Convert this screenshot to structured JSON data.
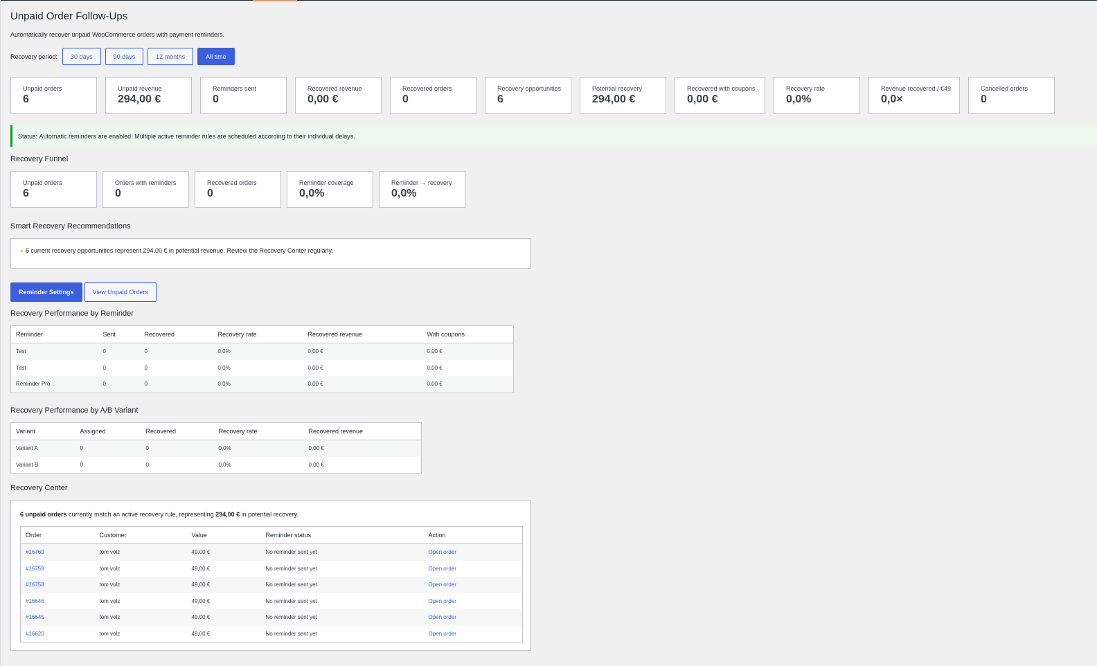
{
  "page": {
    "title": "Unpaid Order Follow-Ups",
    "subtitle": "Automatically recover unpaid WooCommerce orders with payment reminders."
  },
  "period": {
    "label": "Recovery period:",
    "options": [
      "30 days",
      "90 days",
      "12 months",
      "All time"
    ],
    "selected": "All time"
  },
  "stats": [
    {
      "label": "Unpaid orders",
      "value": "6"
    },
    {
      "label": "Unpaid revenue",
      "value": "294,00 €"
    },
    {
      "label": "Reminders sent",
      "value": "0"
    },
    {
      "label": "Recovered revenue",
      "value": "0,00 €"
    },
    {
      "label": "Recovered orders",
      "value": "0"
    },
    {
      "label": "Recovery opportunities",
      "value": "6"
    },
    {
      "label": "Potential recovery",
      "value": "294,00 €"
    },
    {
      "label": "Recovered with coupons",
      "value": "0,00 €"
    },
    {
      "label": "Recovery rate",
      "value": "0,0%"
    },
    {
      "label": "Revenue recovered / €49",
      "value": "0,0×"
    },
    {
      "label": "Cancelled orders",
      "value": "0"
    }
  ],
  "status": {
    "prefix": "Status:",
    "text": "Automatic reminders are enabled. Multiple active reminder rules are scheduled according to their individual delays."
  },
  "funnel": {
    "title": "Recovery Funnel",
    "items": [
      {
        "label": "Unpaid orders",
        "value": "6"
      },
      {
        "label": "Orders with reminders",
        "value": "0"
      },
      {
        "label": "Recovered orders",
        "value": "0"
      },
      {
        "label": "Reminder coverage",
        "value": "0,0%"
      },
      {
        "label": "Reminder → recovery",
        "value": "0,0%"
      }
    ]
  },
  "recommendations": {
    "title": "Smart Recovery Recommendations",
    "text": "6 current recovery opportunities represent 294,00 € in potential revenue. Review the Recovery Center regularly."
  },
  "actions": {
    "settings": "Reminder Settings",
    "view_unpaid": "View Unpaid Orders"
  },
  "by_reminder": {
    "title": "Recovery Performance by Reminder",
    "columns": [
      "Reminder",
      "Sent",
      "Recovered",
      "Recovery rate",
      "Recovered revenue",
      "With coupons"
    ],
    "rows": [
      [
        "Test",
        "0",
        "0",
        "0,0%",
        "0,00 €",
        "0,00 €"
      ],
      [
        "Test",
        "0",
        "0",
        "0,0%",
        "0,00 €",
        "0,00 €"
      ],
      [
        "Reminder Pro",
        "0",
        "0",
        "0,0%",
        "0,00 €",
        "0,00 €"
      ]
    ]
  },
  "by_variant": {
    "title": "Recovery Performance by A/B Variant",
    "columns": [
      "Variant",
      "Assigned",
      "Recovered",
      "Recovery rate",
      "Recovered revenue"
    ],
    "rows": [
      [
        "Variant A",
        "0",
        "0",
        "0,0%",
        "0,00 €"
      ],
      [
        "Variant B",
        "0",
        "0",
        "0,0%",
        "0,00 €"
      ]
    ]
  },
  "recovery_center": {
    "title": "Recovery Center",
    "intro_count": "6 unpaid orders",
    "intro_mid": " currently match an active recovery rule, representing ",
    "intro_amount": "294,00 €",
    "intro_end": " in potential recovery.",
    "columns": [
      "Order",
      "Customer",
      "Value",
      "Reminder status",
      "Action"
    ],
    "rows": [
      {
        "order": "#16760",
        "customer": "tom volz",
        "value": "49,00 €",
        "status": "No reminder sent yet",
        "action": "Open order"
      },
      {
        "order": "#16759",
        "customer": "tom volz",
        "value": "49,00 €",
        "status": "No reminder sent yet",
        "action": "Open order"
      },
      {
        "order": "#16758",
        "customer": "tom volz",
        "value": "49,00 €",
        "status": "No reminder sent yet",
        "action": "Open order"
      },
      {
        "order": "#16646",
        "customer": "tom volz",
        "value": "49,00 €",
        "status": "No reminder sent yet",
        "action": "Open order"
      },
      {
        "order": "#16645",
        "customer": "tom volz",
        "value": "49,00 €",
        "status": "No reminder sent yet",
        "action": "Open order"
      },
      {
        "order": "#16620",
        "customer": "tom volz",
        "value": "49,00 €",
        "status": "No reminder sent yet",
        "action": "Open order"
      }
    ]
  }
}
